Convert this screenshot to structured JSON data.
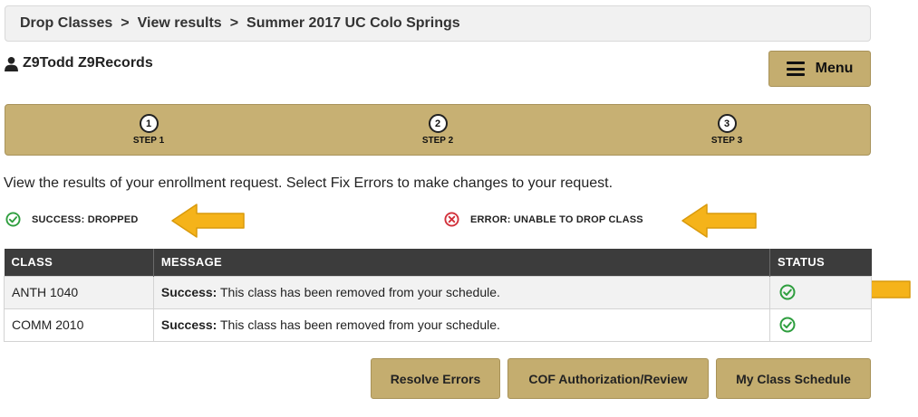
{
  "breadcrumb": [
    "Drop Classes",
    "View results",
    "Summer 2017 UC Colo Springs"
  ],
  "breadcrumb_separator": ">",
  "user": {
    "name": "Z9Todd Z9Records",
    "icon": "user-icon"
  },
  "menu": {
    "label": "Menu",
    "icon": "hamburger-icon"
  },
  "steps": [
    {
      "number": "1",
      "label": "STEP 1"
    },
    {
      "number": "2",
      "label": "STEP 2"
    },
    {
      "number": "3",
      "label": "STEP 3"
    }
  ],
  "instructions": "View the results of your enrollment request.  Select Fix Errors to make changes to your request.",
  "legend": {
    "success": {
      "label": "SUCCESS: DROPPED",
      "icon": "check-circle-icon",
      "color": "#2e9e3e"
    },
    "error": {
      "label": "ERROR: UNABLE TO DROP CLASS",
      "icon": "x-circle-icon",
      "color": "#d2303a"
    }
  },
  "table": {
    "headers": [
      "CLASS",
      "MESSAGE",
      "STATUS"
    ],
    "rows": [
      {
        "class": "ANTH 1040",
        "message_bold": "Success:",
        "message": " This class has been removed from your schedule.",
        "status": "success"
      },
      {
        "class": "COMM 2010",
        "message_bold": "Success:",
        "message": " This class has been removed from your schedule.",
        "status": "success"
      }
    ]
  },
  "buttons": {
    "resolve": "Resolve Errors",
    "cof": "COF Authorization/Review",
    "schedule": "My Class Schedule"
  },
  "colors": {
    "gold": "#c4ad6f",
    "header_dark": "#3c3c3c",
    "arrow": "#f5b31a"
  }
}
